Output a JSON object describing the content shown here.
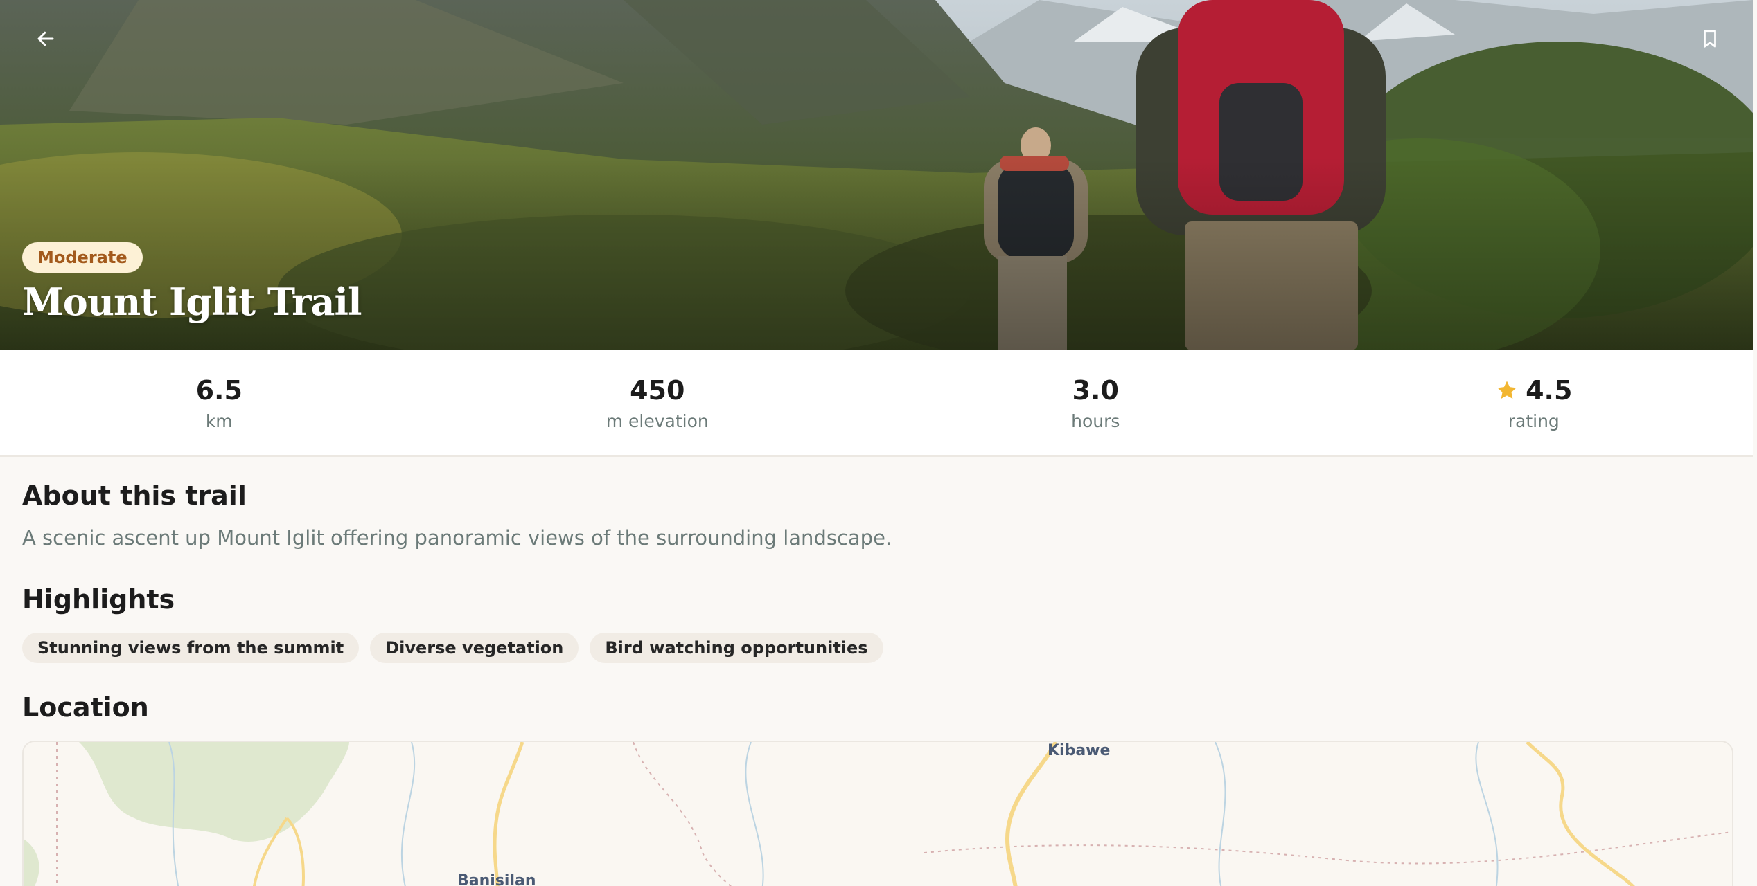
{
  "trail": {
    "difficulty": "Moderate",
    "name": "Mount Iglit Trail"
  },
  "stats": [
    {
      "value": "6.5",
      "label": "km"
    },
    {
      "value": "450",
      "label": "m elevation"
    },
    {
      "value": "3.0",
      "label": "hours"
    },
    {
      "value": "4.5",
      "label": "rating",
      "icon": "star-icon"
    }
  ],
  "about": {
    "title": "About this trail",
    "text": "A scenic ascent up Mount Iglit offering panoramic views of the surrounding landscape."
  },
  "highlights": {
    "title": "Highlights",
    "items": [
      "Stunning views from the summit",
      "Diverse vegetation",
      "Bird watching opportunities"
    ]
  },
  "location": {
    "title": "Location",
    "map_labels": [
      "Kibawe",
      "Banisilan"
    ]
  },
  "icons": {
    "back": "arrow-left-icon",
    "bookmark": "bookmark-icon"
  },
  "colors": {
    "badge_bg": "#fdf1d6",
    "badge_text": "#a35a1c",
    "star": "#f2b632",
    "chip_bg": "#f1ece5",
    "muted_text": "#6b7a78"
  }
}
